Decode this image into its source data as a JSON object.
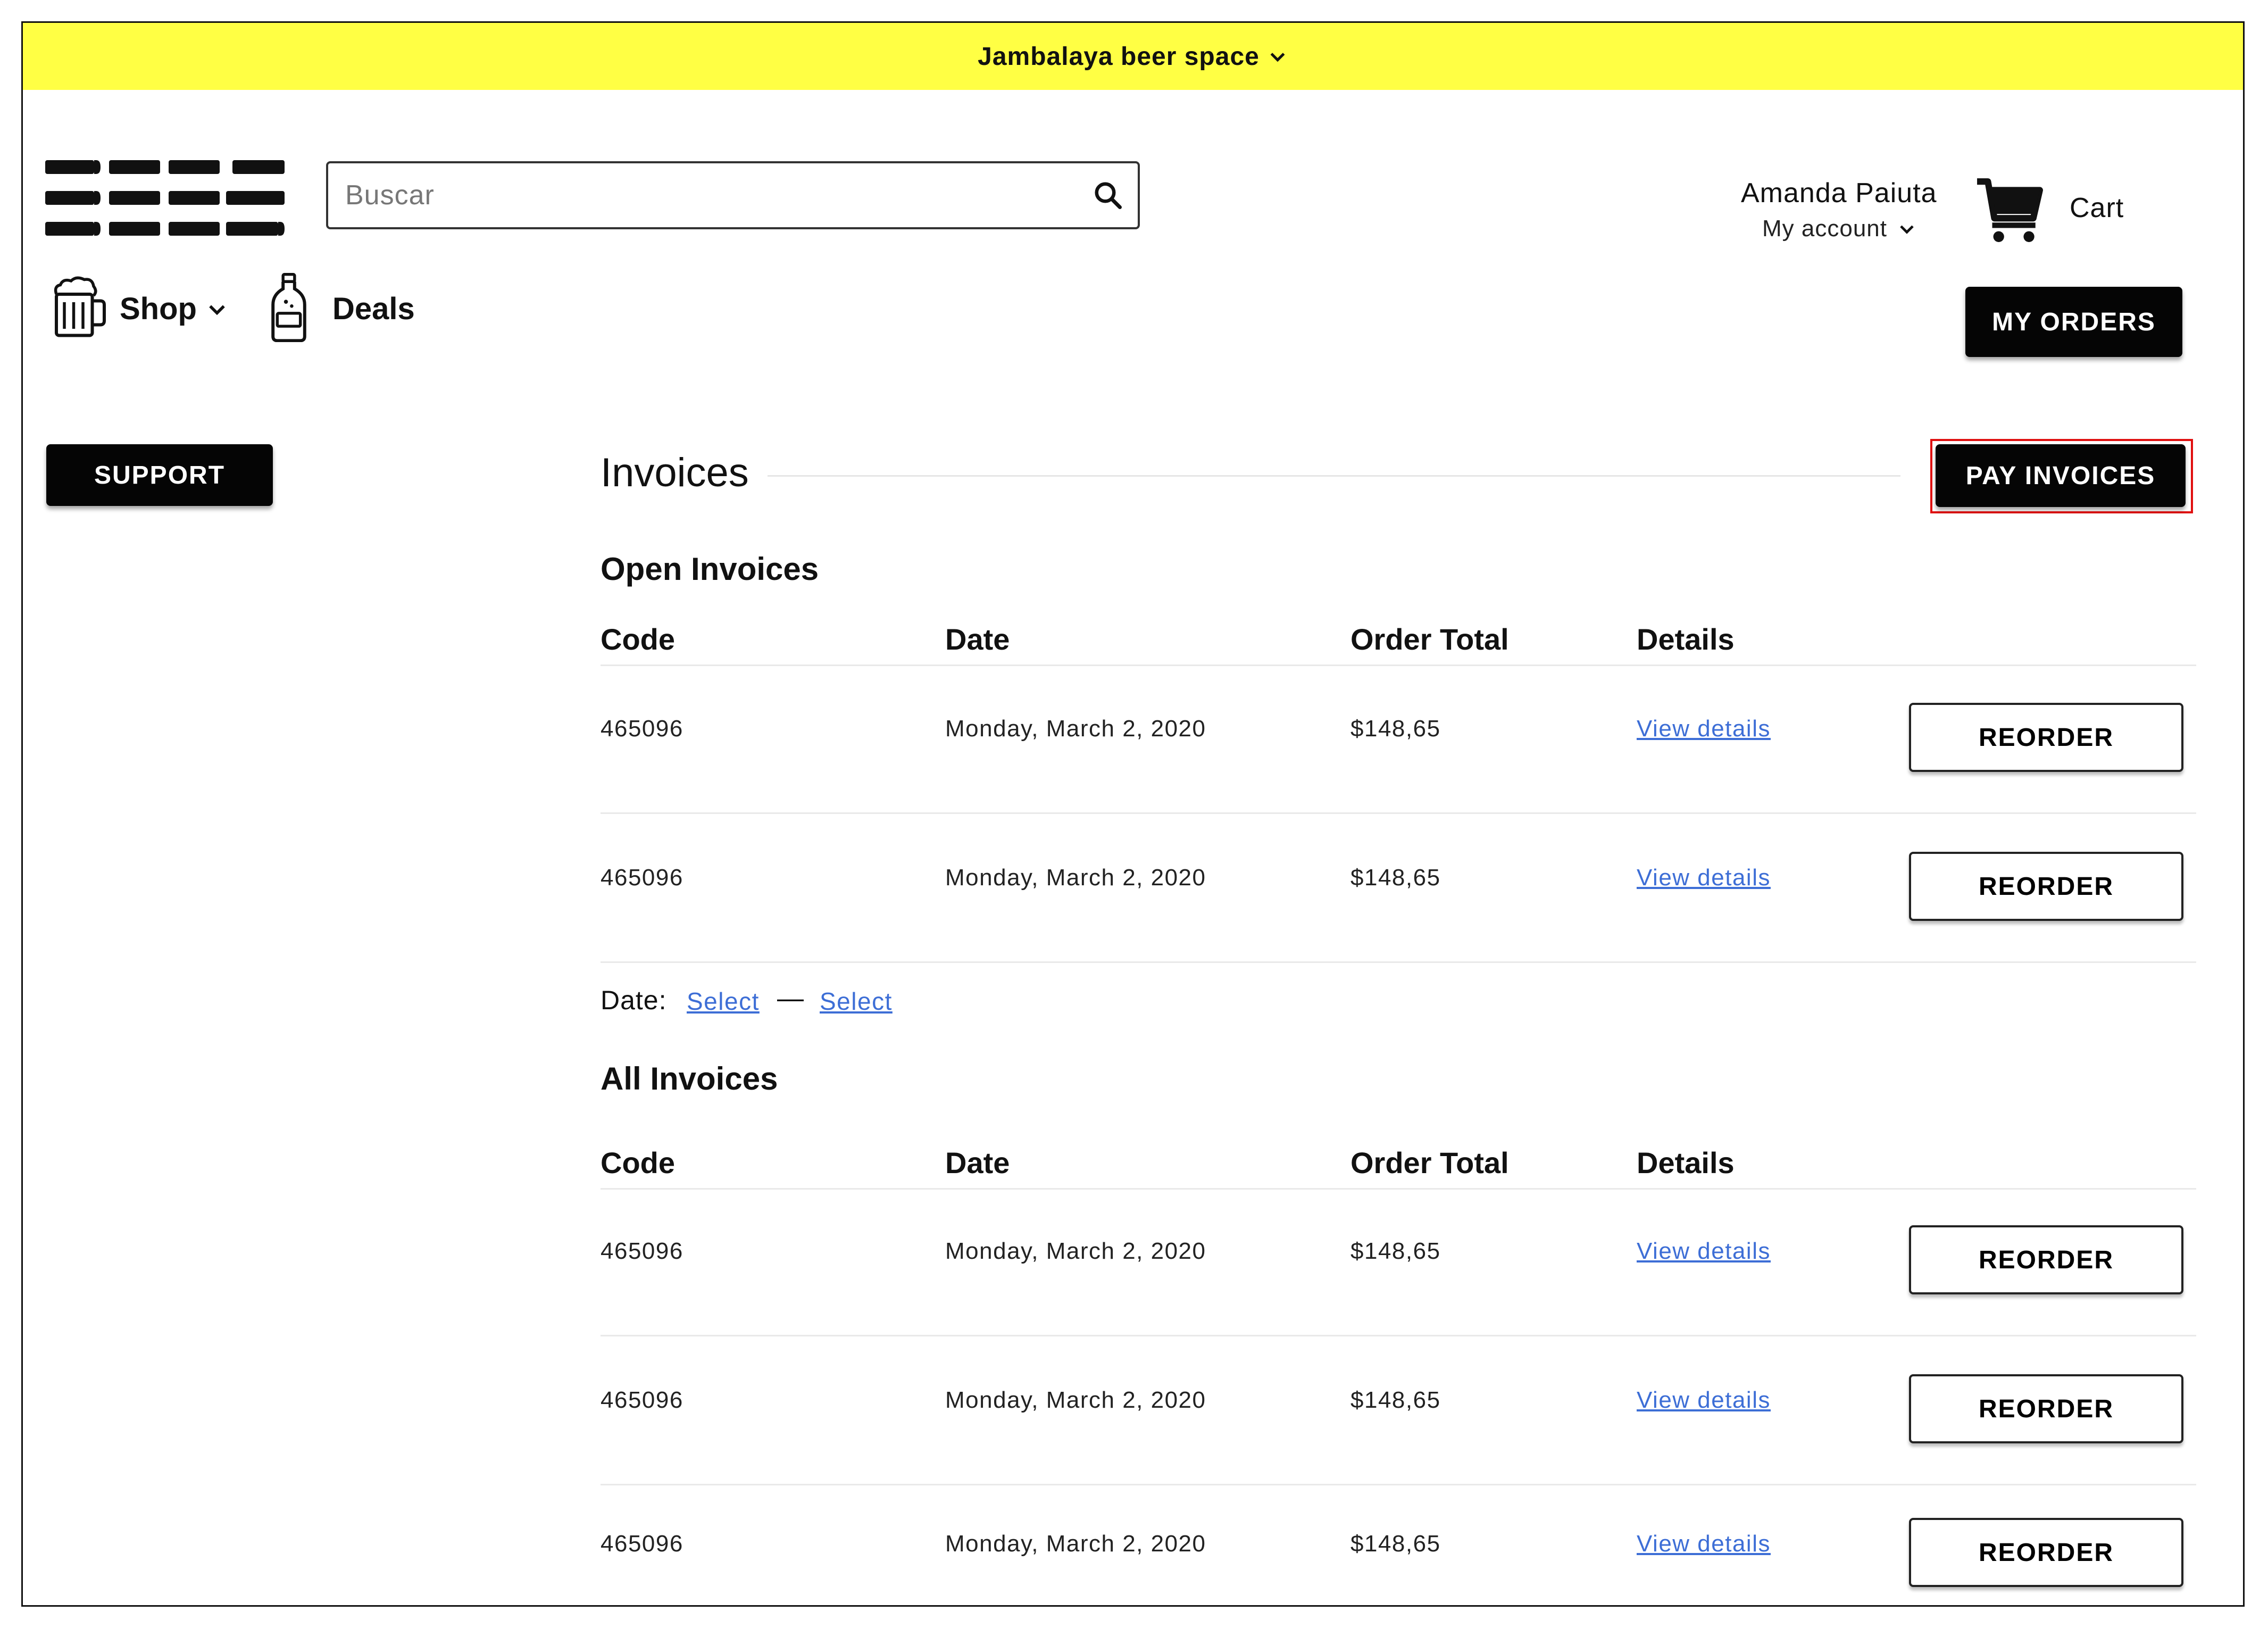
{
  "banner": {
    "store_name": "Jambalaya beer space"
  },
  "search": {
    "placeholder": "Buscar"
  },
  "account": {
    "name": "Amanda Paiuta",
    "menu_label": "My account"
  },
  "cart": {
    "label": "Cart"
  },
  "nav": {
    "shop_label": "Shop",
    "deals_label": "Deals"
  },
  "buttons": {
    "my_orders": "MY ORDERS",
    "support": "SUPPORT",
    "pay_invoices": "PAY INVOICES"
  },
  "page_title": "Invoices",
  "table_headers": {
    "code": "Code",
    "date": "Date",
    "order_total": "Order Total",
    "details": "Details"
  },
  "open_invoices": {
    "title": "Open Invoices",
    "rows": [
      {
        "code": "465096",
        "date": "Monday, March 2, 2020",
        "total": "$148,65",
        "details_link": "View details",
        "action": "REORDER"
      },
      {
        "code": "465096",
        "date": "Monday, March 2, 2020",
        "total": "$148,65",
        "details_link": "View details",
        "action": "REORDER"
      }
    ]
  },
  "date_filter": {
    "label": "Date:",
    "start": "Select",
    "separator": "—",
    "end": "Select"
  },
  "all_invoices": {
    "title": "All Invoices",
    "rows": [
      {
        "code": "465096",
        "date": "Monday, March 2, 2020",
        "total": "$148,65",
        "details_link": "View details",
        "action": "REORDER"
      },
      {
        "code": "465096",
        "date": "Monday, March 2, 2020",
        "total": "$148,65",
        "details_link": "View details",
        "action": "REORDER"
      },
      {
        "code": "465096",
        "date": "Monday, March 2, 2020",
        "total": "$148,65",
        "details_link": "View details",
        "action": "REORDER"
      }
    ]
  },
  "colors": {
    "banner": "#ffff44",
    "primary_button": "#050505",
    "link": "#3d6ed6",
    "highlight": "#e01010"
  }
}
